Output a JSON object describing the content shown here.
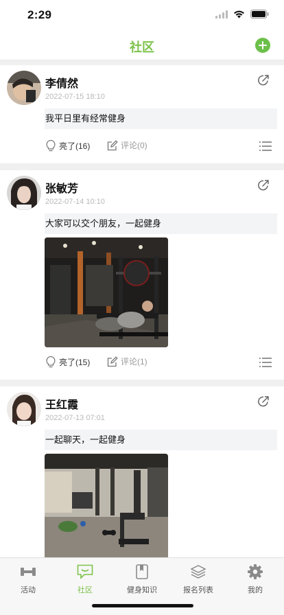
{
  "status": {
    "time": "2:29"
  },
  "nav": {
    "title": "社区"
  },
  "posts": [
    {
      "author": "李倩然",
      "date": "2022-07-15 18:10",
      "content": "我平日里有经常健身",
      "likes": "亮了(16)",
      "comments": "评论(0)"
    },
    {
      "author": "张敏芳",
      "date": "2022-07-14 10:10",
      "content": "大家可以交个朋友，一起健身",
      "likes": "亮了(15)",
      "comments": "评论(1)"
    },
    {
      "author": "王红霞",
      "date": "2022-07-13 07:01",
      "content": "一起聊天，一起健身"
    }
  ],
  "tabs": [
    {
      "label": "活动",
      "icon": "dumbbell-icon"
    },
    {
      "label": "社区",
      "icon": "chat-bubble-icon"
    },
    {
      "label": "健身知识",
      "icon": "book-icon"
    },
    {
      "label": "报名列表",
      "icon": "layers-icon"
    },
    {
      "label": "我的",
      "icon": "gear-icon"
    }
  ],
  "colors": {
    "accent": "#7cc24a",
    "muted": "#b8b8b8"
  }
}
